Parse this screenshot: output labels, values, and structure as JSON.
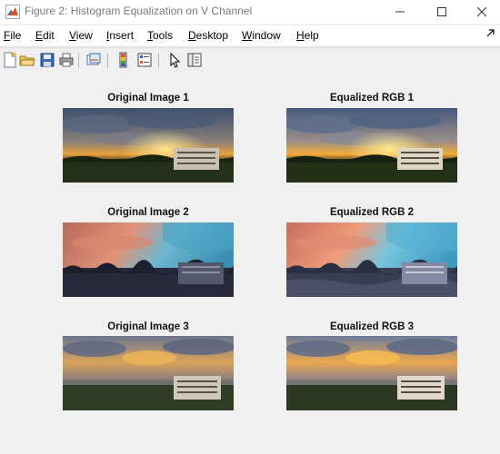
{
  "window": {
    "title": "Figure 2: Histogram Equalization on V Channel"
  },
  "menu": {
    "items": [
      {
        "key": "F",
        "rest": "ile"
      },
      {
        "key": "E",
        "rest": "dit"
      },
      {
        "key": "V",
        "rest": "iew"
      },
      {
        "key": "I",
        "rest": "nsert"
      },
      {
        "key": "T",
        "rest": "ools"
      },
      {
        "key": "D",
        "rest": "esktop"
      },
      {
        "key": "W",
        "rest": "indow"
      },
      {
        "key": "H",
        "rest": "elp"
      }
    ]
  },
  "toolbar": {
    "buttons": [
      "new-figure-icon",
      "open-file-icon",
      "save-icon",
      "print-icon",
      "link-plot-icon",
      "insert-colorbar-icon",
      "insert-legend-icon",
      "edit-plot-icon",
      "property-inspector-icon"
    ]
  },
  "panels": [
    {
      "title": "Original Image 1",
      "scene": "sunset-clouds",
      "variant": "original"
    },
    {
      "title": "Equalized RGB 1",
      "scene": "sunset-clouds",
      "variant": "equalized"
    },
    {
      "title": "Original Image 2",
      "scene": "pink-teal-sky",
      "variant": "original"
    },
    {
      "title": "Equalized RGB 2",
      "scene": "pink-teal-sky",
      "variant": "equalized"
    },
    {
      "title": "Original Image 3",
      "scene": "golden-clouds",
      "variant": "original"
    },
    {
      "title": "Equalized RGB 3",
      "scene": "golden-clouds",
      "variant": "equalized"
    }
  ]
}
